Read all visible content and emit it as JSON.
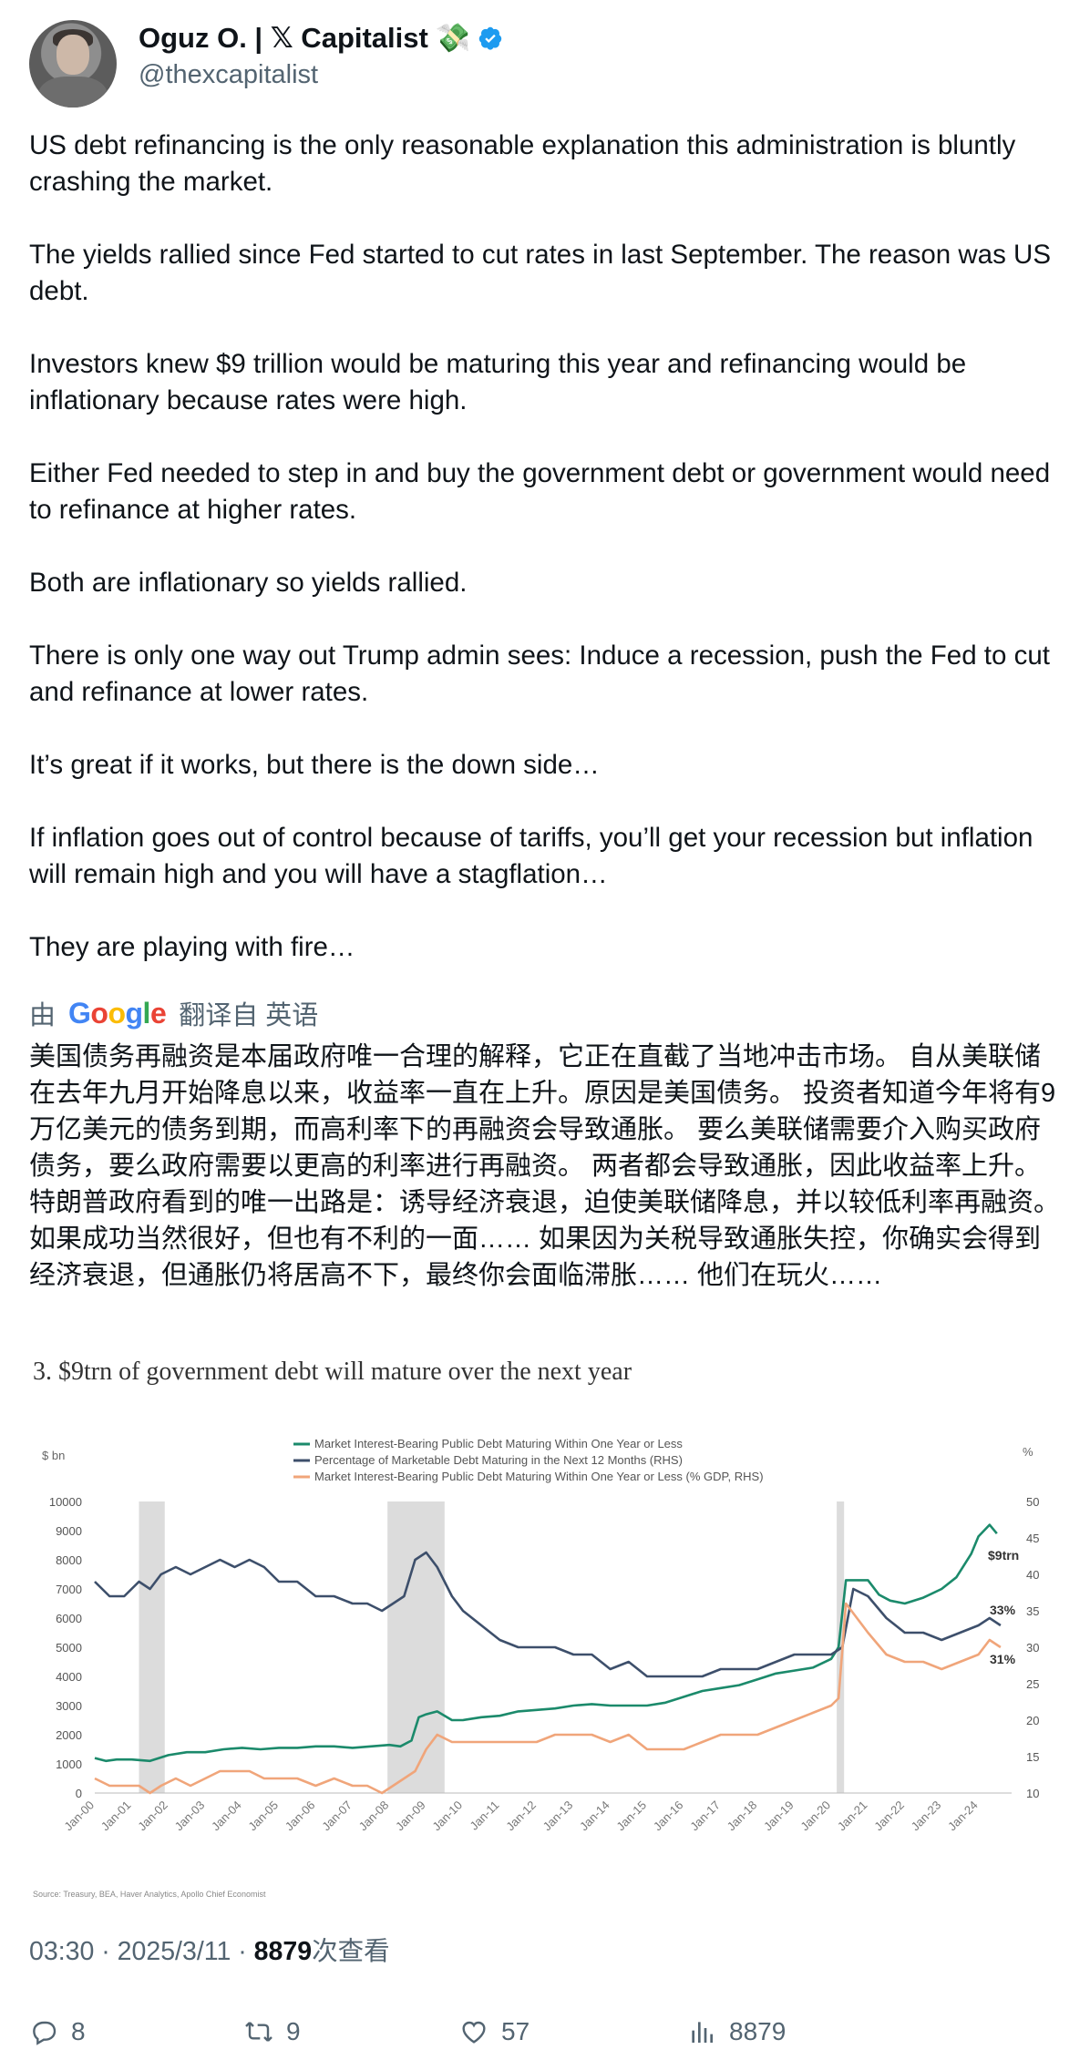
{
  "author": {
    "display_name": "Oguz O. | 𝕏 Capitalist",
    "emoji": "💸",
    "handle": "@thexcapitalist"
  },
  "tweet": {
    "paragraphs": [
      "US debt refinancing is the only reasonable explanation this administration is bluntly crashing the market.",
      "The yields rallied since Fed started to cut rates in last September. The reason was US debt.",
      "Investors knew $9 trillion would be maturing this year and refinancing would be inflationary because rates were high.",
      "Either Fed needed to step in and buy the government debt or government would need to refinance at higher rates.",
      "Both are inflationary so yields rallied.",
      "There is only one way out Trump admin sees: Induce a recession, push the Fed to cut and refinance at lower rates.",
      "It’s great if it works, but there is the down side…",
      "If inflation goes out of control because of tariffs, you’ll get your recession but inflation will remain high and you will have a stagflation…",
      "They are playing with fire…"
    ]
  },
  "translation": {
    "prefix": "由",
    "provider": "Google",
    "suffix": "翻译自 英语",
    "text": "美国债务再融资是本届政府唯一合理的解释，它正在直截了当地冲击市场。 自从美联储在去年九月开始降息以来，收益率一直在上升。原因是美国债务。 投资者知道今年将有9万亿美元的债务到期，而高利率下的再融资会导致通胀。 要么美联储需要介入购买政府债务，要么政府需要以更高的利率进行再融资。 两者都会导致通胀，因此收益率上升。 特朗普政府看到的唯一出路是：诱导经济衰退，迫使美联储降息，并以较低利率再融资。 如果成功当然很好，但也有不利的一面…… 如果因为关税导致通胀失控，你确实会得到经济衰退，但通胀仍将居高不下，最终你会面临滞胀…… 他们在玩火……"
  },
  "meta": {
    "time": "03:30 · 2025/3/11 · ",
    "views": "8879",
    "views_suffix": "次查看"
  },
  "actions": {
    "replies": "8",
    "retweets": "9",
    "likes": "57",
    "views": "8879"
  },
  "colors": {
    "green": "#1b8a6b",
    "navy": "#3d4f6b",
    "orange": "#f0a57a",
    "recession": "#dcdcdc",
    "verified": "#1d9bf0"
  },
  "chart_data": {
    "type": "line",
    "title": "3. $9trn of government debt will mature over the next year",
    "ylabel_left": "$ bn",
    "ylabel_right": "%",
    "ylim_left": [
      0,
      10000
    ],
    "ylim_right": [
      10,
      50
    ],
    "yticks_left": [
      "0",
      "1000",
      "2000",
      "3000",
      "4000",
      "5000",
      "6000",
      "7000",
      "8000",
      "9000",
      "10000"
    ],
    "yticks_right": [
      "10",
      "15",
      "20",
      "25",
      "30",
      "35",
      "40",
      "45",
      "50"
    ],
    "xticks": [
      "Jan-00",
      "Jan-01",
      "Jan-02",
      "Jan-03",
      "Jan-04",
      "Jan-05",
      "Jan-06",
      "Jan-07",
      "Jan-08",
      "Jan-09",
      "Jan-10",
      "Jan-11",
      "Jan-12",
      "Jan-13",
      "Jan-14",
      "Jan-15",
      "Jan-16",
      "Jan-17",
      "Jan-18",
      "Jan-19",
      "Jan-20",
      "Jan-21",
      "Jan-22",
      "Jan-23",
      "Jan-24"
    ],
    "recessions": [
      [
        2001.2,
        2001.9
      ],
      [
        2007.95,
        2009.5
      ],
      [
        2020.15,
        2020.35
      ]
    ],
    "legend": [
      "Market Interest-Bearing Public Debt Maturing Within One Year or Less",
      "Percentage of Marketable Debt Maturing in the Next 12 Months (RHS)",
      "Market Interest-Bearing Public Debt Maturing Within One Year or Less (% GDP, RHS)"
    ],
    "annotations": [
      "$9trn",
      "33%",
      "31%"
    ],
    "source": "Source: Treasury, BEA, Haver Analytics, Apollo Chief Economist",
    "series": [
      {
        "name": "Market Interest-Bearing Public Debt Maturing Within One Year or Less",
        "axis": "left",
        "x": [
          2000.0,
          2000.3,
          2000.6,
          2001.0,
          2001.5,
          2002.0,
          2002.5,
          2003.0,
          2003.5,
          2004.0,
          2004.5,
          2005.0,
          2005.5,
          2006.0,
          2006.5,
          2007.0,
          2007.5,
          2008.0,
          2008.3,
          2008.6,
          2008.8,
          2009.0,
          2009.3,
          2009.7,
          2010.0,
          2010.5,
          2011.0,
          2011.5,
          2012.0,
          2012.5,
          2013.0,
          2013.5,
          2014.0,
          2014.5,
          2015.0,
          2015.5,
          2016.0,
          2016.5,
          2017.0,
          2017.5,
          2018.0,
          2018.5,
          2019.0,
          2019.5,
          2020.0,
          2020.2,
          2020.4,
          2020.6,
          2021.0,
          2021.3,
          2021.6,
          2022.0,
          2022.5,
          2023.0,
          2023.4,
          2023.8,
          2024.0,
          2024.3,
          2024.5
        ],
        "y": [
          1200,
          1100,
          1150,
          1150,
          1100,
          1300,
          1400,
          1400,
          1500,
          1550,
          1500,
          1550,
          1550,
          1600,
          1600,
          1550,
          1600,
          1650,
          1600,
          1800,
          2600,
          2700,
          2800,
          2500,
          2500,
          2600,
          2650,
          2800,
          2850,
          2900,
          3000,
          3050,
          3000,
          3000,
          3000,
          3100,
          3300,
          3500,
          3600,
          3700,
          3900,
          4100,
          4200,
          4300,
          4600,
          5000,
          7300,
          7300,
          7300,
          6800,
          6600,
          6500,
          6700,
          7000,
          7400,
          8200,
          8800,
          9200,
          8900
        ]
      },
      {
        "name": "Percentage of Marketable Debt Maturing in the Next 12 Months (RHS)",
        "axis": "right",
        "x": [
          2000.0,
          2000.4,
          2000.8,
          2001.2,
          2001.5,
          2001.8,
          2002.2,
          2002.6,
          2003.0,
          2003.4,
          2003.8,
          2004.2,
          2004.6,
          2005.0,
          2005.5,
          2006.0,
          2006.5,
          2007.0,
          2007.4,
          2007.8,
          2008.1,
          2008.4,
          2008.7,
          2009.0,
          2009.3,
          2009.7,
          2010.0,
          2010.5,
          2011.0,
          2011.5,
          2012.0,
          2012.5,
          2013.0,
          2013.5,
          2014.0,
          2014.5,
          2015.0,
          2015.5,
          2016.0,
          2016.5,
          2017.0,
          2017.5,
          2018.0,
          2018.5,
          2019.0,
          2019.5,
          2020.0,
          2020.3,
          2020.6,
          2021.0,
          2021.5,
          2022.0,
          2022.5,
          2023.0,
          2023.5,
          2024.0,
          2024.3,
          2024.6
        ],
        "y": [
          39,
          37,
          37,
          39,
          38,
          40,
          41,
          40,
          41,
          42,
          41,
          42,
          41,
          39,
          39,
          37,
          37,
          36,
          36,
          35,
          36,
          37,
          42,
          43,
          41,
          37,
          35,
          33,
          31,
          30,
          30,
          30,
          29,
          29,
          27,
          28,
          26,
          26,
          26,
          26,
          27,
          27,
          27,
          28,
          29,
          29,
          29,
          30,
          38,
          37,
          34,
          32,
          32,
          31,
          32,
          33,
          34,
          33
        ]
      },
      {
        "name": "Market Interest-Bearing Public Debt Maturing Within One Year or Less (% GDP, RHS)",
        "axis": "right",
        "x": [
          2000.0,
          2000.4,
          2000.8,
          2001.2,
          2001.5,
          2001.8,
          2002.2,
          2002.6,
          2003.0,
          2003.4,
          2003.8,
          2004.2,
          2004.6,
          2005.0,
          2005.5,
          2006.0,
          2006.5,
          2007.0,
          2007.4,
          2007.8,
          2008.1,
          2008.4,
          2008.7,
          2009.0,
          2009.3,
          2009.7,
          2010.0,
          2010.5,
          2011.0,
          2011.5,
          2012.0,
          2012.5,
          2013.0,
          2013.5,
          2014.0,
          2014.5,
          2015.0,
          2015.5,
          2016.0,
          2016.5,
          2017.0,
          2017.5,
          2018.0,
          2018.5,
          2019.0,
          2019.5,
          2020.0,
          2020.2,
          2020.4,
          2020.7,
          2021.0,
          2021.5,
          2022.0,
          2022.5,
          2023.0,
          2023.5,
          2024.0,
          2024.3,
          2024.6
        ],
        "y": [
          12,
          11,
          11,
          11,
          10,
          11,
          12,
          11,
          12,
          13,
          13,
          13,
          12,
          12,
          12,
          11,
          12,
          11,
          11,
          10,
          11,
          12,
          13,
          16,
          18,
          17,
          17,
          17,
          17,
          17,
          17,
          18,
          18,
          18,
          17,
          18,
          16,
          16,
          16,
          17,
          18,
          18,
          18,
          19,
          20,
          21,
          22,
          23,
          36,
          34,
          32,
          29,
          28,
          28,
          27,
          28,
          29,
          31,
          30
        ]
      }
    ]
  }
}
